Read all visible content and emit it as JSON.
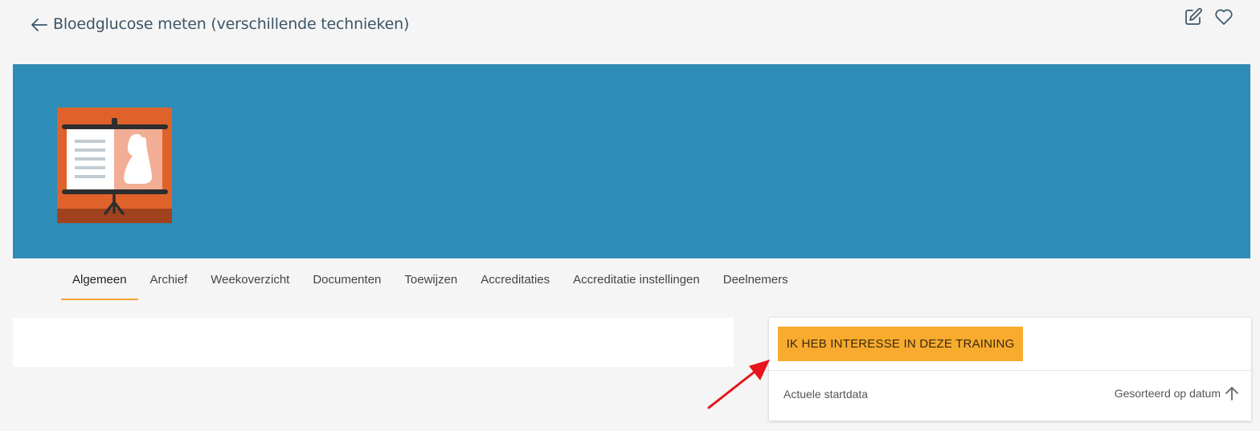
{
  "header": {
    "title": "Bloedglucose meten (verschillende technieken)",
    "back_icon": "arrow-left-icon",
    "actions": [
      {
        "icon": "edit-icon"
      },
      {
        "icon": "heart-icon"
      }
    ]
  },
  "banner": {
    "color": "#2e8cb7",
    "image_icon": "presentation-board-icon"
  },
  "tabs": [
    {
      "label": "Algemeen",
      "active": true
    },
    {
      "label": "Archief"
    },
    {
      "label": "Weekoverzicht"
    },
    {
      "label": "Documenten"
    },
    {
      "label": "Toewijzen"
    },
    {
      "label": "Accreditaties"
    },
    {
      "label": "Accreditatie instellingen"
    },
    {
      "label": "Deelnemers"
    }
  ],
  "sidebar_card": {
    "interest_button": "IK HEB INTERESSE IN DEZE TRAINING",
    "section_label": "Actuele startdata",
    "sort_label": "Gesorteerd op datum",
    "sort_icon": "arrow-up-icon"
  },
  "colors": {
    "accent": "#f8ab2e",
    "banner": "#2e8cb7",
    "annotation_arrow": "#e8141b"
  }
}
